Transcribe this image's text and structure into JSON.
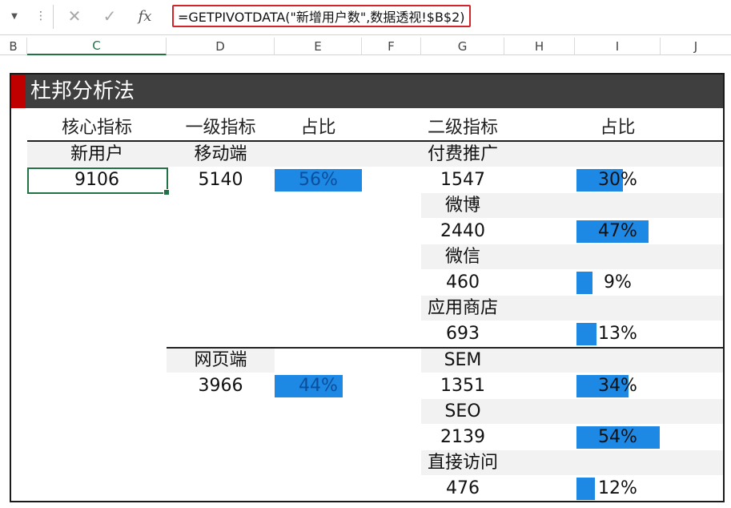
{
  "formula_bar": {
    "formula": "=GETPIVOTDATA(\"新增用户数\",数据透视!$B$2)",
    "cancel_icon": "✕",
    "enter_icon": "✓",
    "fx_label": "fx"
  },
  "columns": [
    "B",
    "C",
    "D",
    "E",
    "F",
    "G",
    "H",
    "I",
    "J"
  ],
  "report": {
    "title": "杜邦分析法",
    "headers": {
      "core": "核心指标",
      "level1": "一级指标",
      "ratio1": "占比",
      "level2": "二级指标",
      "ratio2": "占比"
    },
    "core": {
      "label": "新用户",
      "value": "9106"
    },
    "level1": [
      {
        "label": "移动端",
        "value": "5140",
        "pct_text": "56%",
        "fraction": 0.56
      },
      {
        "label": "网页端",
        "value": "3966",
        "pct_text": "44%",
        "fraction": 0.44
      }
    ],
    "level2": [
      {
        "label": "付费推广",
        "value": "1547",
        "pct_text": "30%",
        "fraction": 0.3
      },
      {
        "label": "微博",
        "value": "2440",
        "pct_text": "47%",
        "fraction": 0.47
      },
      {
        "label": "微信",
        "value": "460",
        "pct_text": "9%",
        "fraction": 0.09
      },
      {
        "label": "应用商店",
        "value": "693",
        "pct_text": "13%",
        "fraction": 0.13
      },
      {
        "label": "SEM",
        "value": "1351",
        "pct_text": "34%",
        "fraction": 0.34
      },
      {
        "label": "SEO",
        "value": "2139",
        "pct_text": "54%",
        "fraction": 0.54
      },
      {
        "label": "直接访问",
        "value": "476",
        "pct_text": "12%",
        "fraction": 0.12
      }
    ],
    "colors": {
      "bar": "#1e88e5",
      "title_bg": "#3f3f3f",
      "accent": "#c00000",
      "band": "#f2f2f2"
    }
  }
}
